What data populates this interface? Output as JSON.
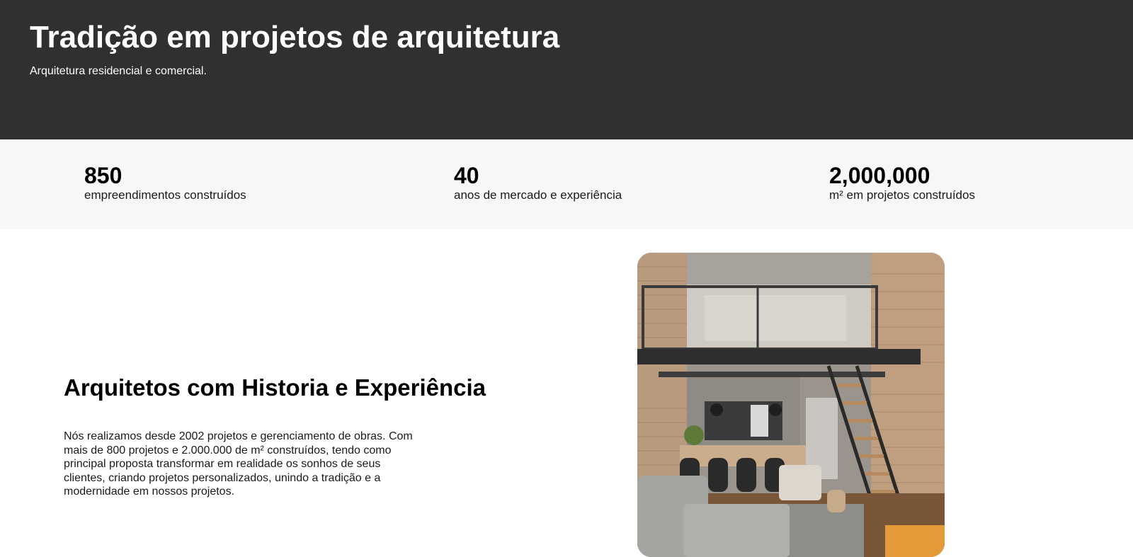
{
  "hero": {
    "title": "Tradição em projetos de arquitetura",
    "subtitle": "Arquitetura residencial e comercial."
  },
  "stats": [
    {
      "value": "850",
      "label": "empreendimentos construídos"
    },
    {
      "value": "40",
      "label": "anos de mercado e experiência"
    },
    {
      "value": "2,000,000",
      "label": "m² em projetos construídos"
    }
  ],
  "about": {
    "title": "Arquitetos com Historia e Experiência",
    "text": "Nós realizamos desde 2002 projetos e gerenciamento de obras. Com mais de 800 projetos e 2.000.000 de m² construídos, tendo como principal proposta transformar em realidade os sonhos de seus clientes, criando projetos personalizados, unindo a tradição e a modernidade em nossos projetos."
  },
  "colors": {
    "hero_bg": "#303030",
    "stats_bg": "#f7f7f7"
  }
}
